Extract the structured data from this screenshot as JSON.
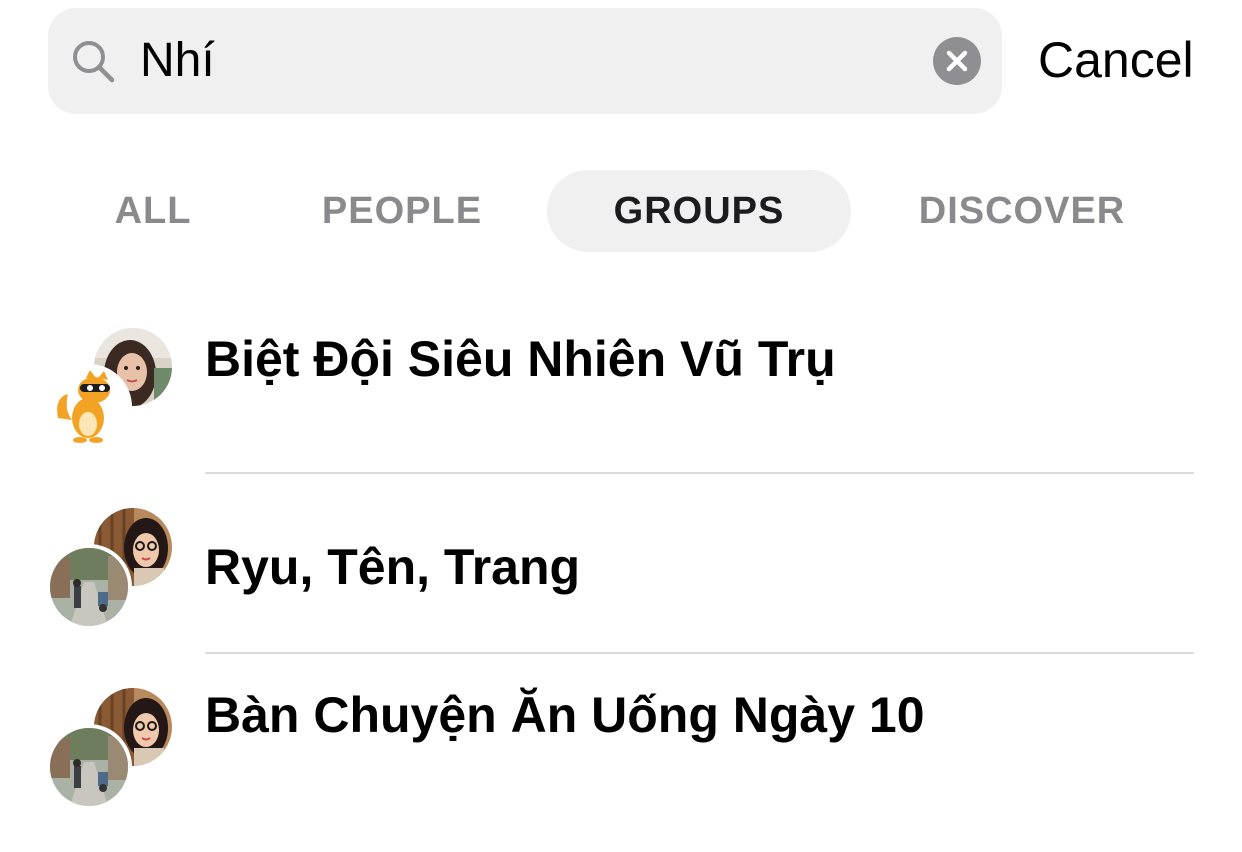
{
  "search": {
    "value": "Nhí",
    "cancel_label": "Cancel"
  },
  "tabs": [
    {
      "label": "ALL",
      "active": false
    },
    {
      "label": "PEOPLE",
      "active": false
    },
    {
      "label": "GROUPS",
      "active": true
    },
    {
      "label": "DISCOVER",
      "active": false
    }
  ],
  "results": [
    {
      "title": "Biệt Đội Siêu Nhiên Vũ Trụ",
      "avatars": [
        "girl-photo",
        "fox-mascot"
      ]
    },
    {
      "title": "Ryu, Tên, Trang",
      "avatars": [
        "girl-glasses-photo",
        "street-photo"
      ]
    },
    {
      "title": "Bàn Chuyện Ăn Uống Ngày 10",
      "avatars": [
        "girl-glasses-photo",
        "street-photo"
      ]
    }
  ],
  "colors": {
    "search_bg": "#f0f0f1",
    "tab_active_bg": "#f0f0f1",
    "tab_inactive_text": "#8a8a8e",
    "clear_button": "#8e8e93",
    "separator": "#dcdcde"
  }
}
